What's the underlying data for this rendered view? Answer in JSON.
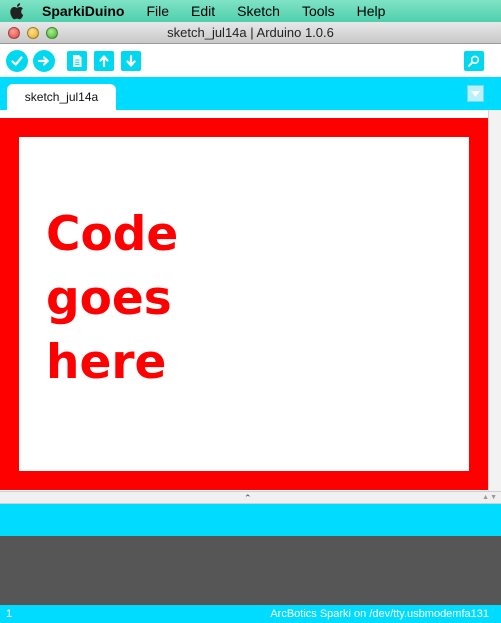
{
  "menubar": {
    "apple_icon": "apple-icon",
    "items": [
      "SparkiDuino",
      "File",
      "Edit",
      "Sketch",
      "Tools",
      "Help"
    ]
  },
  "window": {
    "title": "sketch_jul14a | Arduino 1.0.6"
  },
  "toolbar": {
    "buttons": [
      {
        "name": "verify",
        "icon": "checkmark-icon"
      },
      {
        "name": "upload",
        "icon": "arrow-right-icon"
      },
      {
        "name": "new",
        "icon": "document-icon"
      },
      {
        "name": "open",
        "icon": "arrow-up-icon"
      },
      {
        "name": "save",
        "icon": "arrow-down-icon"
      },
      {
        "name": "serial-monitor",
        "icon": "magnifier-icon"
      }
    ]
  },
  "tabs": [
    {
      "label": "sketch_jul14a",
      "active": true
    }
  ],
  "editor": {
    "lines": [
      "Code",
      "goes",
      "here"
    ]
  },
  "status": {
    "line_number": "1",
    "board": "ArcBotics Sparki on /dev/tty.usbmodemfa131"
  },
  "colors": {
    "accent": "#00dcff",
    "highlight": "#ff0000",
    "console_bg": "#565656"
  }
}
